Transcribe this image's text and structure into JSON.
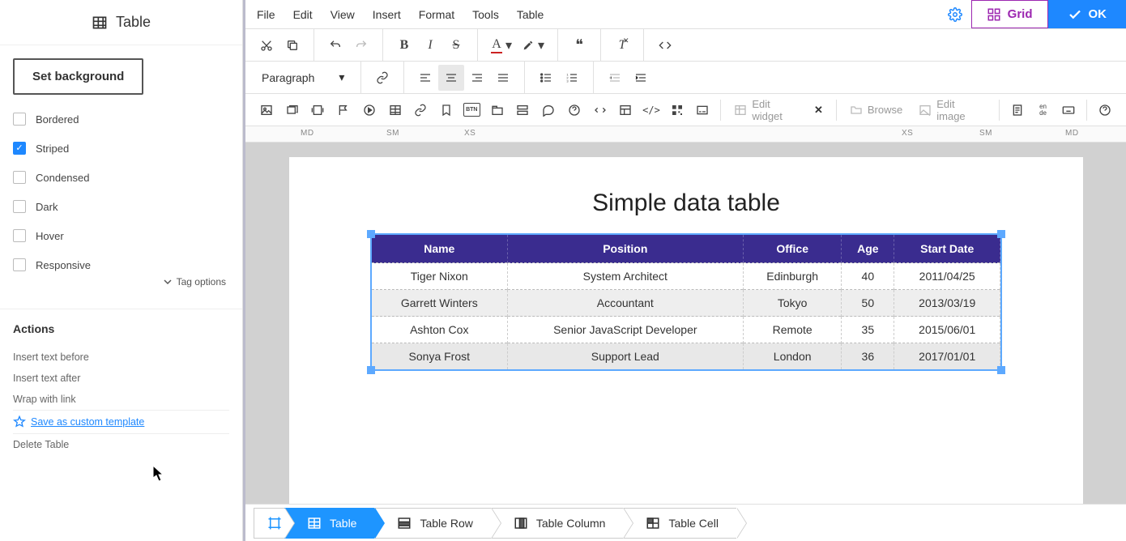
{
  "sidebar": {
    "title": "Table",
    "set_background": "Set background",
    "options": [
      {
        "label": "Bordered",
        "checked": false
      },
      {
        "label": "Striped",
        "checked": true
      },
      {
        "label": "Condensed",
        "checked": false
      },
      {
        "label": "Dark",
        "checked": false
      },
      {
        "label": "Hover",
        "checked": false
      },
      {
        "label": "Responsive",
        "checked": false
      }
    ],
    "tag_options": "Tag options",
    "actions_heading": "Actions",
    "actions": {
      "insert_before": "Insert text before",
      "insert_after": "Insert text after",
      "wrap_link": "Wrap with link",
      "save_template": "Save as custom template",
      "delete": "Delete Table"
    }
  },
  "menu": {
    "file": "File",
    "edit": "Edit",
    "view": "View",
    "insert": "Insert",
    "format": "Format",
    "tools": "Tools",
    "table": "Table"
  },
  "top_buttons": {
    "grid": "Grid",
    "ok": "OK"
  },
  "toolbar": {
    "paragraph": "Paragraph",
    "edit_widget": "Edit widget",
    "browse": "Browse",
    "edit_image": "Edit image",
    "lang": "en\nde"
  },
  "ruler": {
    "md_l": "MD",
    "sm_l": "SM",
    "xs_l": "XS",
    "xs_r": "XS",
    "sm_r": "SM",
    "md_r": "MD"
  },
  "doc": {
    "title": "Simple data table",
    "columns": [
      "Name",
      "Position",
      "Office",
      "Age",
      "Start Date"
    ],
    "rows": [
      [
        "Tiger Nixon",
        "System Architect",
        "Edinburgh",
        "40",
        "2011/04/25"
      ],
      [
        "Garrett Winters",
        "Accountant",
        "Tokyo",
        "50",
        "2013/03/19"
      ],
      [
        "Ashton Cox",
        "Senior JavaScript Developer",
        "Remote",
        "35",
        "2015/06/01"
      ],
      [
        "Sonya Frost",
        "Support Lead",
        "London",
        "36",
        "2017/01/01"
      ]
    ]
  },
  "breadcrumbs": {
    "table": "Table",
    "row": "Table Row",
    "column": "Table Column",
    "cell": "Table Cell"
  },
  "chart_data": {
    "type": "table",
    "title": "Simple data table",
    "columns": [
      "Name",
      "Position",
      "Office",
      "Age",
      "Start Date"
    ],
    "rows": [
      [
        "Tiger Nixon",
        "System Architect",
        "Edinburgh",
        40,
        "2011/04/25"
      ],
      [
        "Garrett Winters",
        "Accountant",
        "Tokyo",
        50,
        "2013/03/19"
      ],
      [
        "Ashton Cox",
        "Senior JavaScript Developer",
        "Remote",
        35,
        "2015/06/01"
      ],
      [
        "Sonya Frost",
        "Support Lead",
        "London",
        36,
        "2017/01/01"
      ]
    ]
  }
}
